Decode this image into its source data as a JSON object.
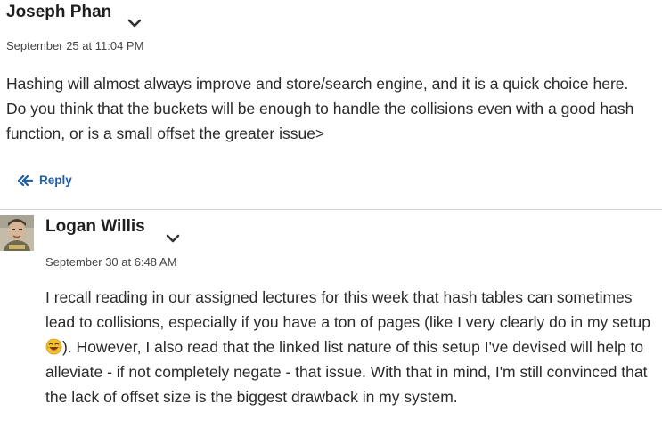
{
  "posts": [
    {
      "author": "Joseph Phan",
      "timestamp": "September 25 at 11:04 PM",
      "body": "Hashing will almost always improve and store/search engine, and it is a quick choice here. Do you think that the buckets will be enough to handle the collisions even with a good hash function, or is a small offset the greater issue>",
      "reply_label": "Reply"
    },
    {
      "author": "Logan Willis",
      "timestamp": "September 30 at 6:48 AM",
      "body_before_emoji": "I recall reading in our assigned lectures for this week that hash tables can sometimes lead to collisions, especially if you have a ton of pages (like I very clearly do in my setup ",
      "emoji": "laughing-with-tears-emoji",
      "body_after_emoji": ").  However, I also read that the linked list nature of this setup I've devised will help to alleviate - if not completely negate - that issue. With that in mind, I'm still convinced that the lack of offset size is the biggest drawback in my system."
    }
  ],
  "colors": {
    "link": "#1d5fa8",
    "divider": "#d4d4d4",
    "emoji_face": "#f6c22b"
  }
}
